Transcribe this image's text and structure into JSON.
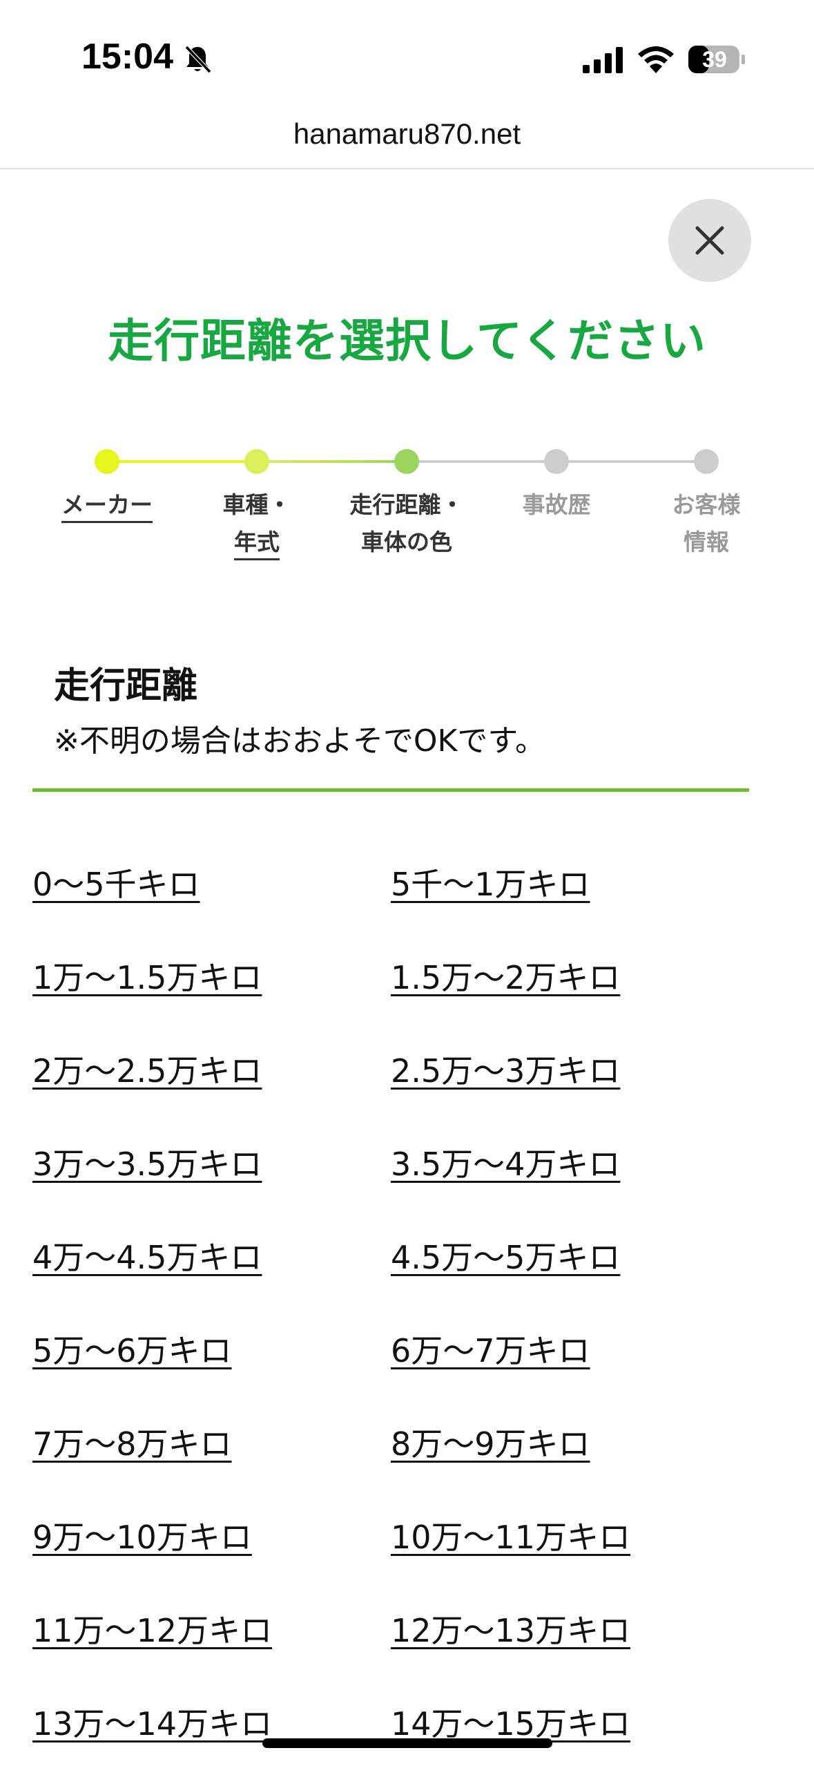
{
  "status_bar": {
    "time": "15:04",
    "battery": "39",
    "icons": [
      "bell-slash-icon",
      "signal-icon",
      "wifi-icon",
      "battery-icon"
    ]
  },
  "browser": {
    "url": "hanamaru870.net"
  },
  "close_icon": "close-icon",
  "title": "走行距離を選択してください",
  "stepper": {
    "steps": [
      {
        "line1": "メーカー",
        "line2": "",
        "state": "done",
        "color": "#e6f51c"
      },
      {
        "line1": "車種・",
        "line2": "年式",
        "state": "done",
        "color": "#d9ef5c"
      },
      {
        "line1": "走行距離・",
        "line2": "車体の色",
        "state": "current",
        "color": "#9bd45e"
      },
      {
        "line1": "事故歴",
        "line2": "",
        "state": "todo",
        "color": "#cccccc"
      },
      {
        "line1": "お客様",
        "line2": "情報",
        "state": "todo",
        "color": "#cccccc"
      }
    ]
  },
  "section": {
    "heading": "走行距離",
    "note": "※不明の場合はおおよそでOKです。",
    "rule_color": "#6cbb2a"
  },
  "options": [
    "0〜5千キロ",
    "5千〜1万キロ",
    "1万〜1.5万キロ",
    "1.5万〜2万キロ",
    "2万〜2.5万キロ",
    "2.5万〜3万キロ",
    "3万〜3.5万キロ",
    "3.5万〜4万キロ",
    "4万〜4.5万キロ",
    "4.5万〜5万キロ",
    "5万〜6万キロ",
    "6万〜7万キロ",
    "7万〜8万キロ",
    "8万〜9万キロ",
    "9万〜10万キロ",
    "10万〜11万キロ",
    "11万〜12万キロ",
    "12万〜13万キロ",
    "13万〜14万キロ",
    "14万〜15万キロ"
  ],
  "colors": {
    "title": "#17a842",
    "accent": "#6cbb2a"
  }
}
